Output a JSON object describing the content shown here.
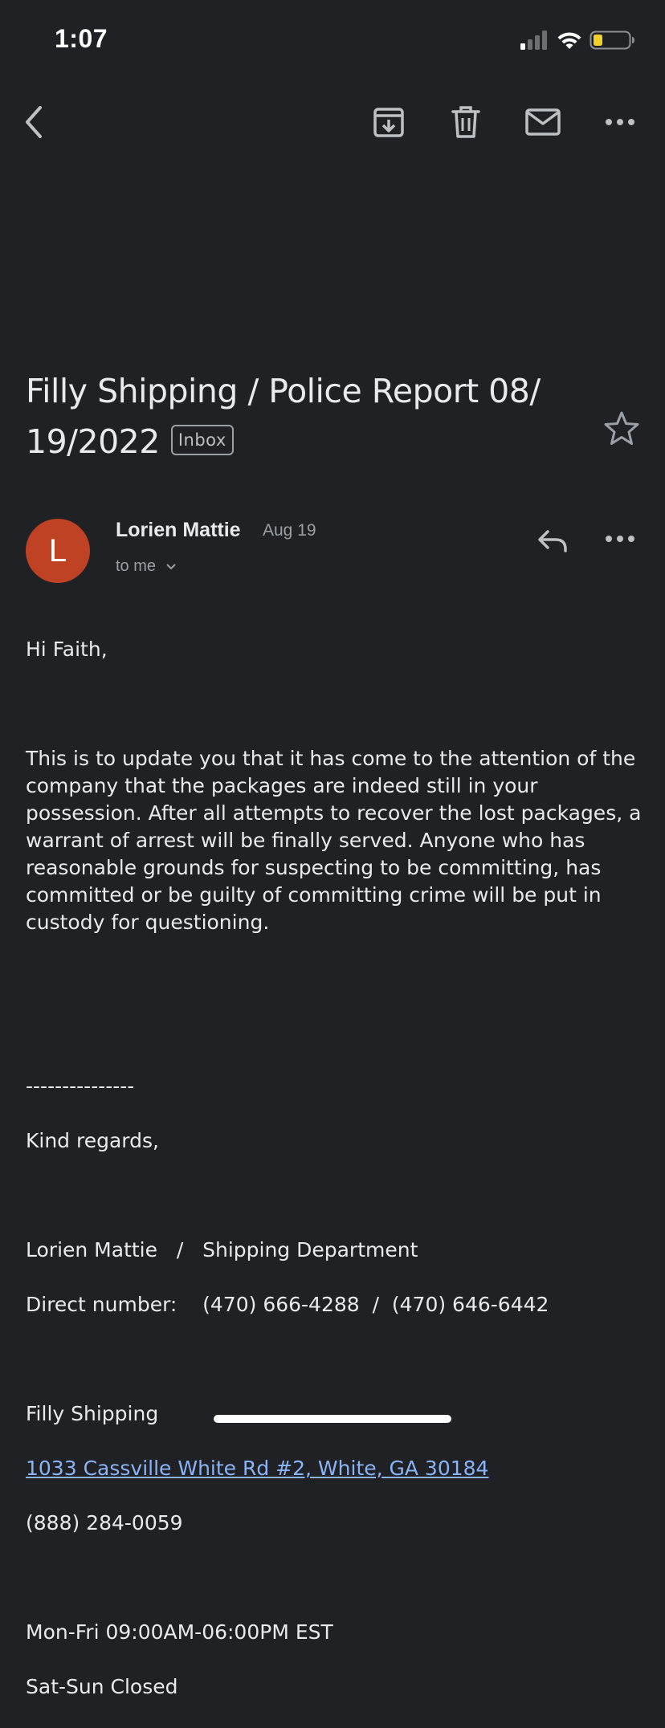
{
  "status_bar": {
    "time": "1:07",
    "battery_color": "#f2d12b"
  },
  "toolbar": {
    "back_icon": "chevron-left-icon",
    "archive_icon": "archive-icon",
    "delete_icon": "trash-icon",
    "mark_unread_icon": "envelope-icon",
    "more_icon": "more-horizontal-icon"
  },
  "email": {
    "subject": "Filly Shipping  / Police Report  08/ 19/2022",
    "label": "Inbox",
    "starred": false,
    "sender": {
      "initial": "L",
      "name": "Lorien Mattie",
      "date": "Aug 19",
      "recipient": "to me",
      "avatar_color": "#bf4224"
    },
    "body": {
      "greeting": "Hi Faith,",
      "paragraph": "This is to update you that it has come to the attention of the company that the packages are indeed still in your possession. After all attempts to recover the lost packages, a warrant of arrest will be finally served. Anyone who has reasonable grounds for suspecting to be committing, has committed or be guilty of committing crime will be put in custody for questioning.",
      "separator": "---------------",
      "closing": "Kind regards,",
      "signature_name": "Lorien Mattie   /   Shipping Department",
      "direct_number": "Direct number:    (470) 666-4288  /  (470) 646-6442",
      "company": "Filly Shipping",
      "address": "1033 Cassville White Rd #2, White, GA 30184",
      "phone": "(888) 284-0059",
      "hours_weekday": "Mon-Fri 09:00AM-06:00PM EST",
      "hours_weekend": "Sat-Sun Closed"
    }
  },
  "colors": {
    "background": "#202124",
    "link": "#8ab4f8",
    "text": "#e8eaed",
    "muted": "#9aa0a6"
  }
}
